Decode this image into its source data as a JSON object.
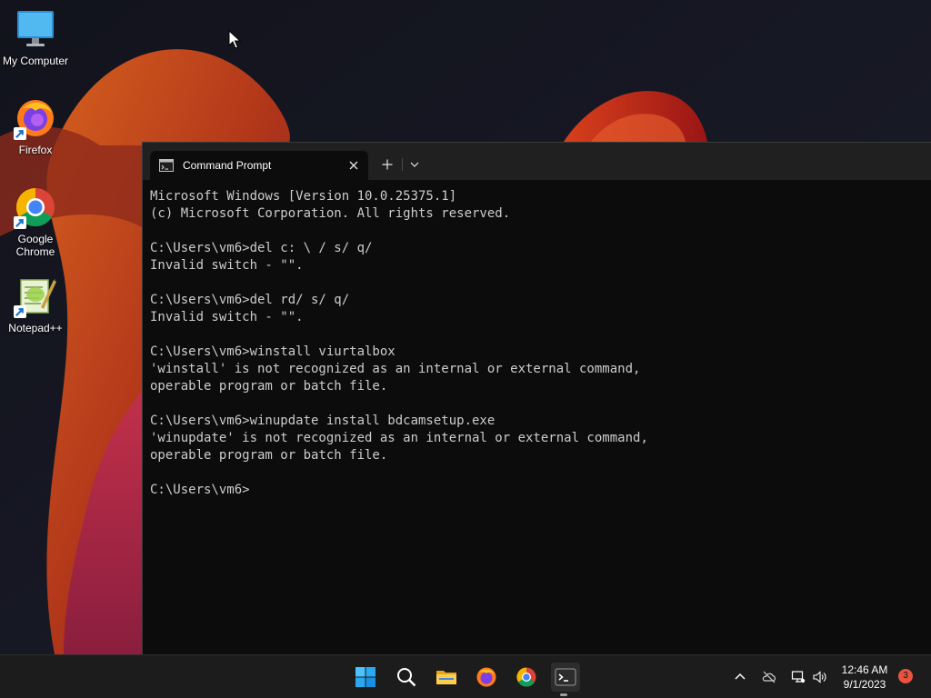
{
  "desktop": {
    "icons": [
      {
        "label": "My Computer"
      },
      {
        "label": "Firefox"
      },
      {
        "label": "Google Chrome"
      },
      {
        "label": "Notepad++"
      }
    ]
  },
  "terminal": {
    "tab_title": "Command Prompt",
    "lines": [
      "Microsoft Windows [Version 10.0.25375.1]",
      "(c) Microsoft Corporation. All rights reserved.",
      "",
      "C:\\Users\\vm6>del c: \\ / s/ q/",
      "Invalid switch - \"\".",
      "",
      "C:\\Users\\vm6>del rd/ s/ q/",
      "Invalid switch - \"\".",
      "",
      "C:\\Users\\vm6>winstall viurtalbox",
      "'winstall' is not recognized as an internal or external command,",
      "operable program or batch file.",
      "",
      "C:\\Users\\vm6>winupdate install bdcamsetup.exe",
      "'winupdate' is not recognized as an internal or external command,",
      "operable program or batch file.",
      "",
      "C:\\Users\\vm6>"
    ]
  },
  "taskbar": {
    "apps": [
      "start-icon",
      "search-icon",
      "file-explorer-icon",
      "firefox-icon",
      "chrome-icon",
      "terminal-icon"
    ],
    "active_app": "terminal-icon",
    "tray": [
      "chevron-up-icon",
      "onedrive-icon",
      "network-icon",
      "volume-icon"
    ],
    "time": "12:46 AM",
    "date": "9/1/2023",
    "notification_count": "3"
  },
  "colors": {
    "terminal_bg": "#0c0c0c",
    "terminal_text": "#cccccc",
    "tabbar_bg": "#202020",
    "taskbar_bg": "#1c1c1c",
    "wallpaper_bg": "#14151f",
    "wallpaper_accent": "#c8421a",
    "notification_badge": "#e8543f"
  }
}
